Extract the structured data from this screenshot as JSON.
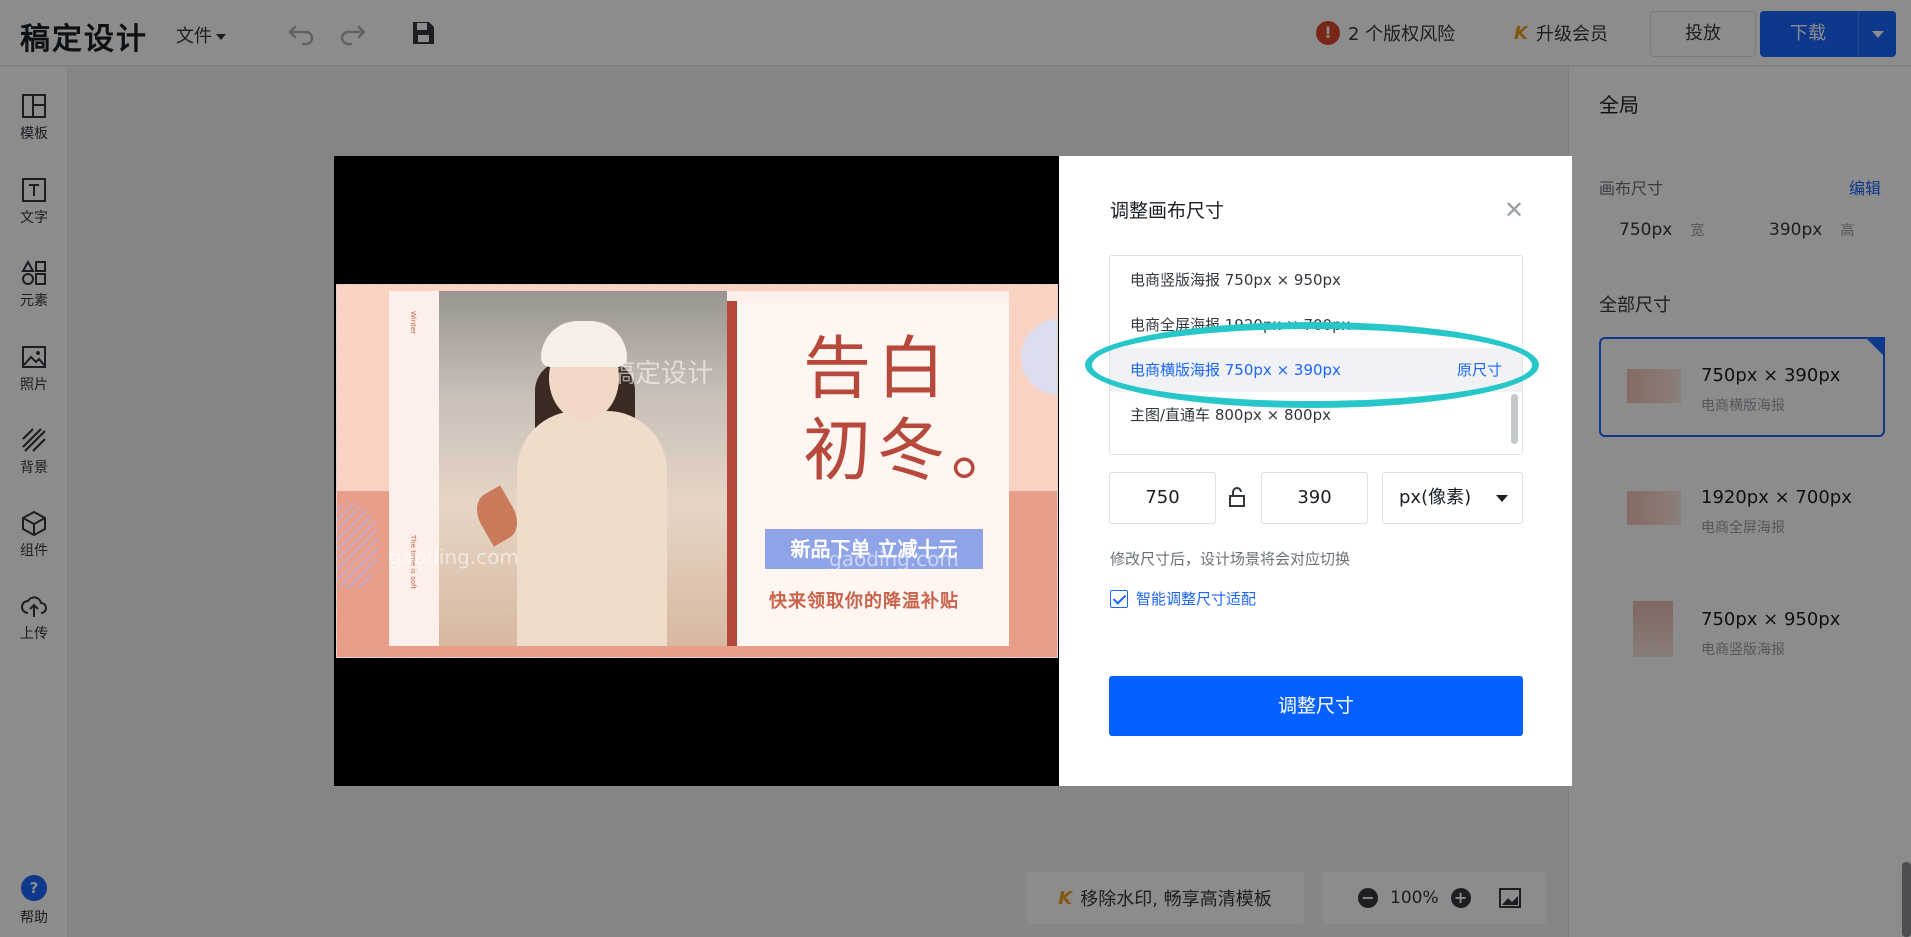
{
  "app": {
    "logo": "稿定设计"
  },
  "topbar": {
    "file_menu": "文件",
    "risk_label": "2 个版权风险",
    "risk_icon_glyph": "!",
    "vip_label": "升级会员",
    "cast_label": "投放",
    "download_label": "下载"
  },
  "sidebar": {
    "items": [
      {
        "label": "模板",
        "icon": "template-icon"
      },
      {
        "label": "文字",
        "icon": "text-icon"
      },
      {
        "label": "元素",
        "icon": "element-icon"
      },
      {
        "label": "照片",
        "icon": "photo-icon"
      },
      {
        "label": "背景",
        "icon": "background-icon"
      },
      {
        "label": "组件",
        "icon": "component-icon"
      },
      {
        "label": "上传",
        "icon": "upload-icon"
      }
    ],
    "help_label": "帮助"
  },
  "right_panel": {
    "title": "全局",
    "canvas_size_label": "画布尺寸",
    "edit_label": "编辑",
    "width_value": "750px",
    "width_unit": "宽",
    "height_value": "390px",
    "height_unit": "高",
    "all_sizes_label": "全部尺寸",
    "cards": [
      {
        "size": "750px × 390px",
        "name": "电商横版海报"
      },
      {
        "size": "1920px × 700px",
        "name": "电商全屏海报"
      },
      {
        "size": "750px × 950px",
        "name": "电商竖版海报"
      }
    ]
  },
  "bottom": {
    "watermark_label": "移除水印, 畅享高清模板",
    "zoom_level": "100%"
  },
  "poster": {
    "headline_line1": "告白",
    "headline_line2": "初冬。",
    "tag": "新品下单 立减十元",
    "subtitle": "快来领取你的降温补贴",
    "vertical_text_top": "Winter",
    "vertical_text_bottom": "The time is soft",
    "watermark_text": "稿定设计",
    "watermark_domain": "gaoding.com"
  },
  "dialog": {
    "title": "调整画布尺寸",
    "presets": [
      {
        "label": "电商竖版海报 750px × 950px"
      },
      {
        "label": "电商全屏海报 1920px × 700px"
      },
      {
        "label": "电商横版海报 750px × 390px",
        "badge": "原尺寸",
        "selected": true
      },
      {
        "label": "主图/直通车 800px × 800px"
      }
    ],
    "width_input": "750",
    "height_input": "390",
    "unit_select": "px(像素)",
    "hint": "修改尺寸后，设计场景将会对应切换",
    "smart_fit_label": "智能调整尺寸适配",
    "smart_fit_checked": true,
    "apply_label": "调整尺寸"
  },
  "colors": {
    "accent": "#1b67ff",
    "highlight_ellipse": "#27c7c9",
    "poster_red": "#b6483c"
  }
}
